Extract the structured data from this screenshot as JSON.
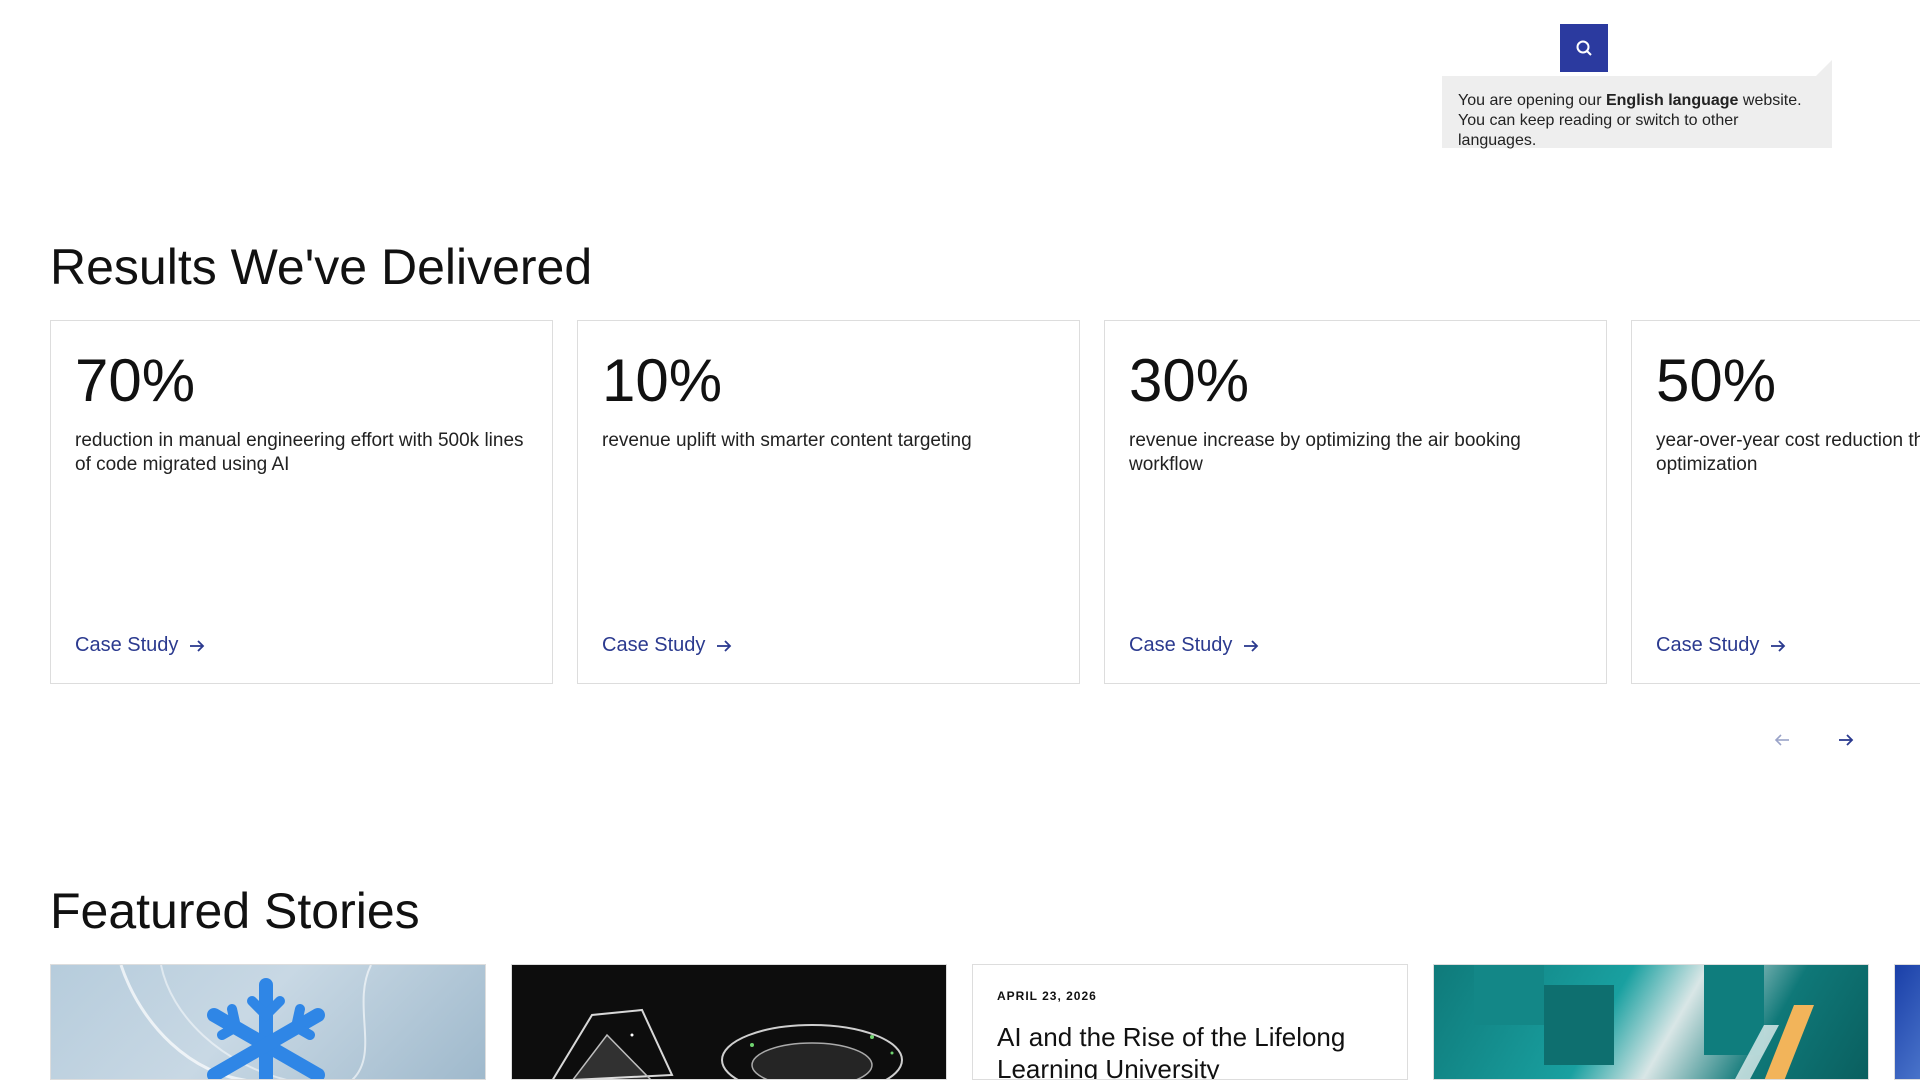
{
  "header": {
    "search_label": "Search"
  },
  "language_popup": {
    "line1_prefix": "You are opening our ",
    "line1_bold": "English language",
    "line1_suffix": " website.",
    "line2": "You can keep reading or switch to other languages."
  },
  "results": {
    "title": "Results We've Delivered",
    "cards": [
      {
        "percent": "70%",
        "description": "reduction in manual engineering effort with 500k lines of code migrated using AI",
        "cta": "Case Study"
      },
      {
        "percent": "10%",
        "description": "revenue uplift with smarter content targeting",
        "cta": "Case Study"
      },
      {
        "percent": "30%",
        "description": "revenue increase by optimizing the air booking workflow",
        "cta": "Case Study"
      },
      {
        "percent": "50%",
        "description": "year-over-year cost reduction thr optimization",
        "cta": "Case Study"
      }
    ]
  },
  "featured": {
    "title": "Featured Stories",
    "story3": {
      "date": "APRIL 23, 2026",
      "headline": "AI and the Rise of the Lifelong Learning University"
    }
  },
  "icons": {
    "search": "search-icon",
    "arrow": "arrow-right-icon",
    "prev": "arrow-left-icon",
    "next": "arrow-right-icon",
    "snowflake": "snowflake-icon"
  },
  "colors": {
    "accent": "#2b3a9f",
    "link": "#2b3a8f",
    "popup_bg": "#eeeeee"
  }
}
